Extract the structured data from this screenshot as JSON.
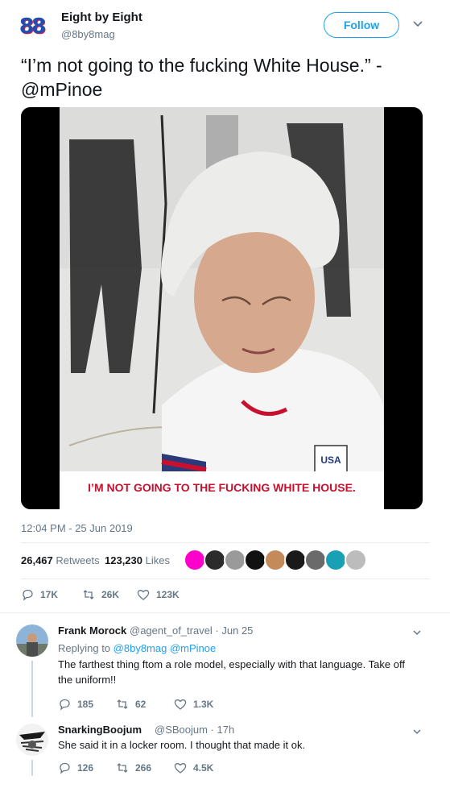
{
  "author": {
    "name": "Eight by Eight",
    "handle": "@8by8mag",
    "logo_text": "88"
  },
  "follow_label": "Follow",
  "tweet": {
    "text": "“I’m not going to the fucking White House.” - @mPinoe",
    "caption": "I’M NOT GOING TO THE FUCKING WHITE HOUSE.",
    "time": "12:04 PM - 25 Jun 2019",
    "retweets_count": "26,467",
    "retweets_label": "Retweets",
    "likes_count": "123,230",
    "likes_label": "Likes",
    "replies": "17K",
    "rts": "26K",
    "hearts": "123K"
  },
  "replies": [
    {
      "name": "Frank Morock",
      "handle": "@agent_of_travel · Jun 25",
      "replying_prefix": "Replying to",
      "replying_to": "@8by8mag @mPinoe",
      "text": "The farthest thing ftom a role model, especially with that language. Take off the uniform!!",
      "replies": "185",
      "retweets": "62",
      "likes": "1.3K"
    },
    {
      "name": "SnarkingBoojum",
      "handle": "@SBoojum · 17h",
      "text": "She said it in a locker room.  I thought that made it ok.",
      "replies": "126",
      "retweets": "266",
      "likes": "4.5K"
    }
  ],
  "colors": {
    "accent": "#1da1f2",
    "caption_red": "#c8102e",
    "muted": "#657786"
  }
}
